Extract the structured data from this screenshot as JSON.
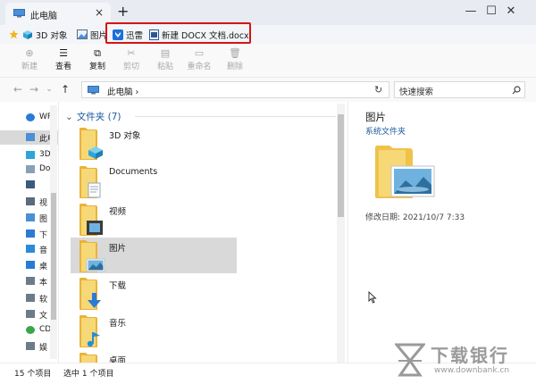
{
  "window": {
    "tab_title": "此电脑",
    "new_tab": "+",
    "minimize": "—",
    "maximize": "☐",
    "close": "✕"
  },
  "favorites": [
    {
      "label": "",
      "icon": "star-icon"
    },
    {
      "label": "3D 对象",
      "icon": "cube-3d-icon"
    },
    {
      "label": "图片",
      "icon": "pictures-icon"
    },
    {
      "label": "迅雷",
      "icon": "xunlei-icon"
    },
    {
      "label": "新建 DOCX 文档.docx",
      "icon": "docx-icon"
    }
  ],
  "toolbar": {
    "new": "新建",
    "view": "查看",
    "copy": "复制",
    "cut": "剪切",
    "paste": "粘贴",
    "rename": "重命名",
    "delete": "删除"
  },
  "address": {
    "path": "此电脑",
    "separator": "›",
    "search_placeholder": "快速搜索"
  },
  "nav_pane": {
    "items": [
      {
        "label": "WP",
        "icon": "cloud-icon",
        "color": "#2a7bd4"
      },
      {
        "label": "此电",
        "icon": "pc-icon",
        "color": "#4b8fd6",
        "selected": true
      },
      {
        "label": "3D",
        "icon": "cube-3d-icon",
        "color": "#2fa4d8"
      },
      {
        "label": "Do",
        "icon": "documents-icon",
        "color": "#8aa0b8"
      },
      {
        "label": "",
        "icon": "phone-icon",
        "color": "#3b5b7a"
      },
      {
        "label": "视",
        "icon": "video-icon",
        "color": "#5a6b7d"
      },
      {
        "label": "图",
        "icon": "pictures-icon",
        "color": "#4b8fd6"
      },
      {
        "label": "下",
        "icon": "download-icon",
        "color": "#2a7bd4"
      },
      {
        "label": "音",
        "icon": "music-icon",
        "color": "#2a8bd8"
      },
      {
        "label": "桌",
        "icon": "desktop-icon",
        "color": "#2a7bd4"
      },
      {
        "label": "本",
        "icon": "drive-icon",
        "color": "#6b7b8c"
      },
      {
        "label": "软",
        "icon": "drive-icon",
        "color": "#6b7b8c"
      },
      {
        "label": "文",
        "icon": "drive-icon",
        "color": "#6b7b8c"
      },
      {
        "label": "CD",
        "icon": "cd-drive-icon",
        "color": "#3aa64a"
      },
      {
        "label": "娱",
        "icon": "drive-icon",
        "color": "#6b7b8c"
      }
    ]
  },
  "content": {
    "group_label": "文件夹",
    "group_count": "(7)",
    "folders": [
      {
        "name": "3D 对象",
        "type": "3d"
      },
      {
        "name": "Documents",
        "type": "docs"
      },
      {
        "name": "视频",
        "type": "video"
      },
      {
        "name": "图片",
        "type": "pictures",
        "selected": true
      },
      {
        "name": "下载",
        "type": "download"
      },
      {
        "name": "音乐",
        "type": "music"
      },
      {
        "name": "桌面",
        "type": "desktop"
      }
    ]
  },
  "preview": {
    "title": "图片",
    "subtitle": "系统文件夹",
    "modified": "修改日期:     2021/10/7 7:33"
  },
  "status": {
    "item_count": "15 个项目",
    "selected_count": "选中 1 个项目"
  },
  "watermark": {
    "title": "下载银行",
    "url": "www.downbank.cn"
  },
  "colors": {
    "accent": "#1b5aa0",
    "highlight_box": "#d21616",
    "selection": "#d9d9d9"
  }
}
